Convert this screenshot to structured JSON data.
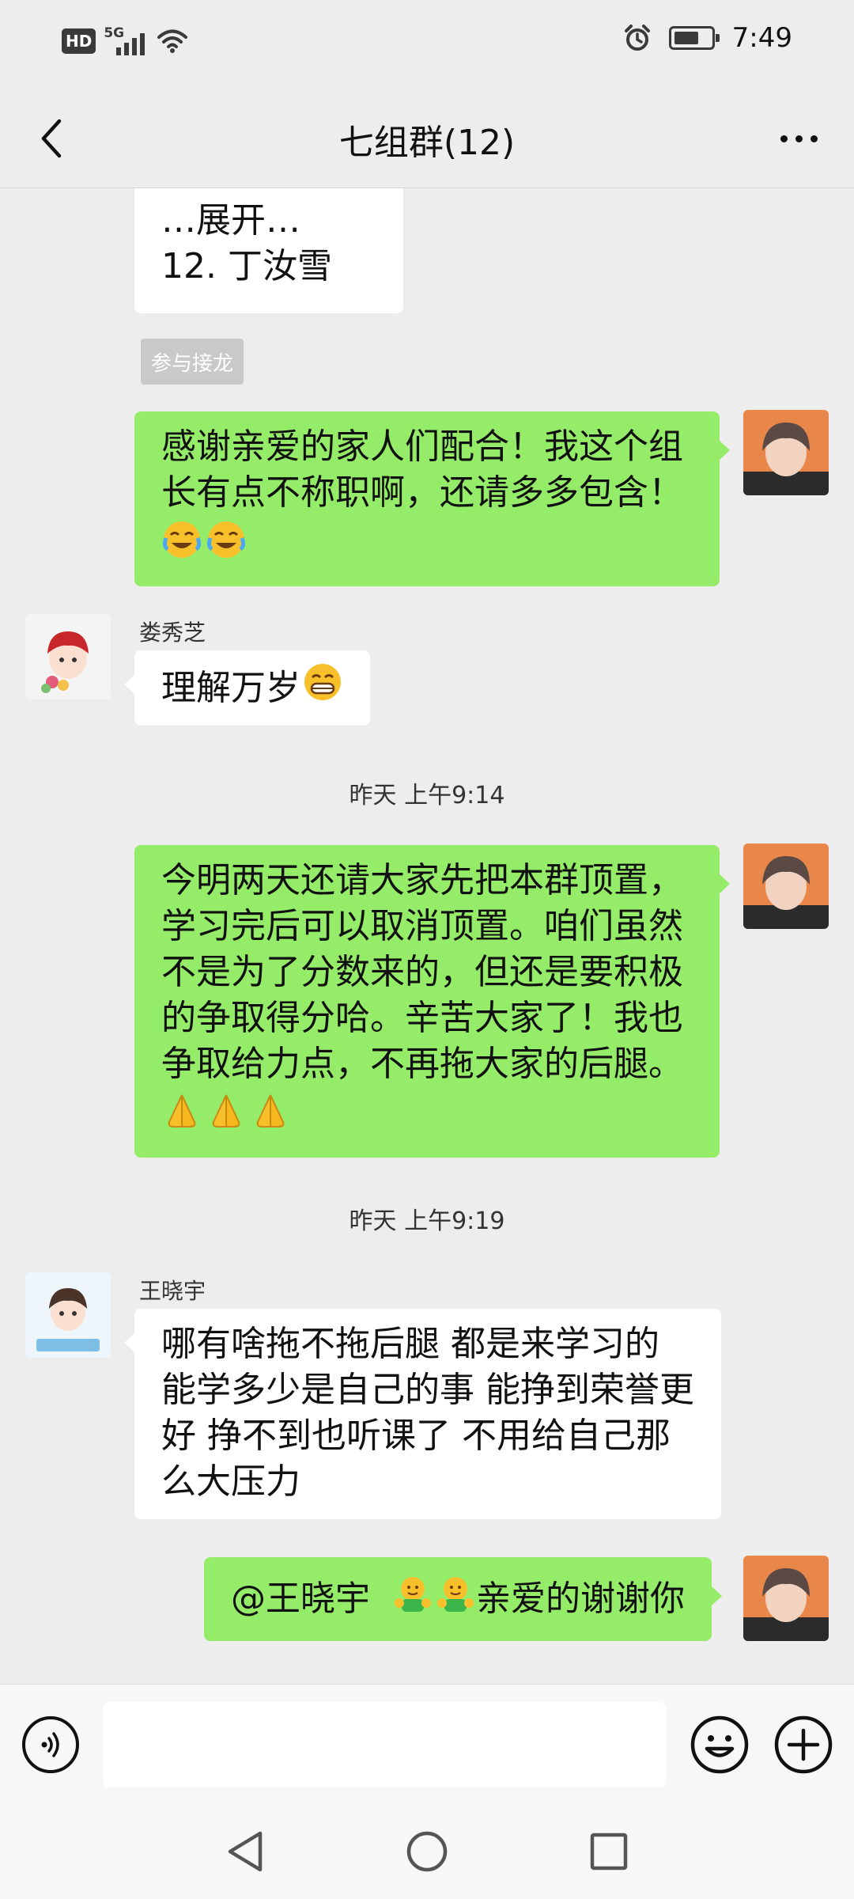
{
  "status_bar": {
    "network_badge": "HD",
    "network_type": "5G",
    "time": "7:49",
    "icons": [
      "hd-icon",
      "signal-icon",
      "wifi-icon",
      "alarm-icon",
      "battery-icon"
    ]
  },
  "header": {
    "title": "七组群(12)",
    "back_icon": "chevron-left-icon",
    "more_icon": "more-dots-icon"
  },
  "messages": {
    "m1": {
      "side": "left",
      "line1": "…展开…",
      "line2": "12. 丁汝雪",
      "action_label": "参与接龙"
    },
    "m2": {
      "side": "right",
      "text": "感谢亲爱的家人们配合！我这个组长有点不称职啊，还请多多包含！",
      "emojis": [
        "face-with-tears-of-joy",
        "face-with-tears-of-joy"
      ]
    },
    "m3": {
      "side": "left",
      "sender": "娄秀芝",
      "text": "理解万岁",
      "emoji": "grinning-face"
    },
    "t1": "昨天 上午9:14",
    "m4": {
      "side": "right",
      "text": "今明两天还请大家先把本群顶置，学习完后可以取消顶置。咱们虽然不是为了分数来的，但还是要积极的争取得分哈。辛苦大家了！我也争取给力点，不再拖大家的后腿。",
      "emojis": [
        "folded-hands",
        "folded-hands",
        "folded-hands"
      ]
    },
    "t2": "昨天 上午9:19",
    "m5": {
      "side": "left",
      "sender": "王晓宇",
      "text": "哪有啥拖不拖后腿 都是来学习的 能学多少是自己的事 能挣到荣誉更好 挣不到也听课了 不用给自己那么大压力"
    },
    "m6": {
      "side": "right",
      "prefix": "@王晓宇",
      "suffix": "亲爱的谢谢你",
      "emojis": [
        "hug",
        "hug"
      ]
    }
  },
  "input_bar": {
    "value": "",
    "icons": [
      "voice-icon",
      "emoji-icon",
      "plus-icon"
    ]
  },
  "system_nav": {
    "icons": [
      "nav-back-icon",
      "nav-home-icon",
      "nav-recents-icon"
    ]
  },
  "colors": {
    "background": "#ededed",
    "bubble_self": "#95ec69",
    "bubble_other": "#ffffff",
    "input_bar": "#f7f7f7"
  }
}
